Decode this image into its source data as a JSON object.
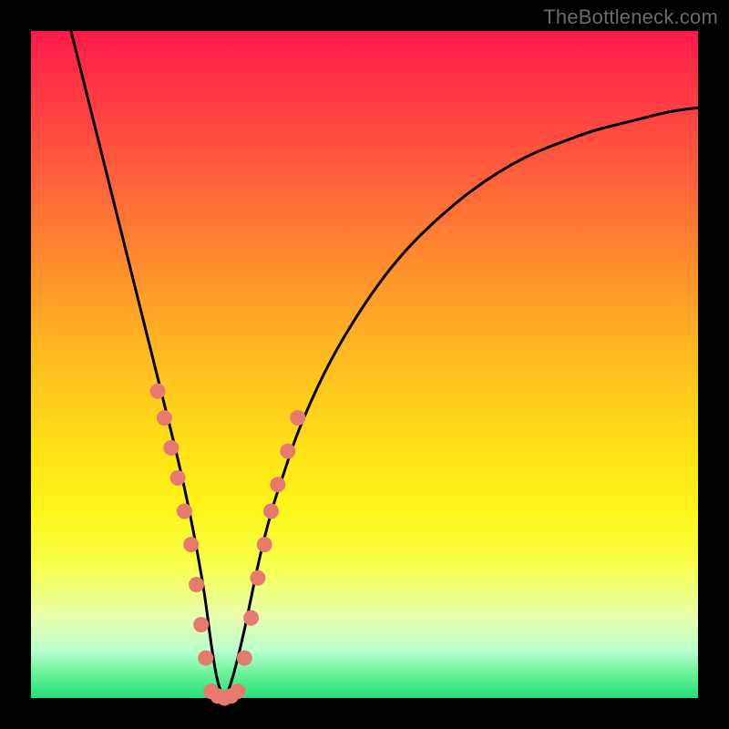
{
  "watermark": "TheBottleneck.com",
  "chart_data": {
    "type": "line",
    "title": "",
    "xlabel": "",
    "ylabel": "",
    "xlim": [
      0,
      100
    ],
    "ylim": [
      0,
      100
    ],
    "legend": false,
    "grid": false,
    "series": [
      {
        "name": "bottleneck-curve",
        "x": [
          6,
          8,
          10,
          12,
          14,
          16,
          18,
          20,
          22,
          24,
          26,
          27,
          28,
          29,
          30,
          32,
          34,
          36,
          38,
          40,
          44,
          48,
          52,
          56,
          60,
          64,
          68,
          72,
          76,
          80,
          84,
          88,
          92,
          96,
          100
        ],
        "values": [
          100,
          92,
          84,
          76,
          68,
          60,
          52,
          44,
          36,
          27,
          16,
          8,
          2,
          0,
          2,
          10,
          20,
          28,
          34,
          40,
          49,
          56,
          62,
          67,
          71,
          74.5,
          77.5,
          80,
          82,
          83.5,
          85,
          86,
          87,
          88,
          88.5
        ]
      }
    ],
    "markers": [
      {
        "name": "left-dots",
        "x": [
          19.0,
          20.0,
          21.0,
          22.0,
          23.0,
          24.0,
          24.8,
          25.5,
          26.2
        ],
        "y": [
          46,
          42,
          37.5,
          33,
          28,
          23,
          17,
          11,
          6
        ]
      },
      {
        "name": "bottom-dots",
        "x": [
          27.0,
          28.0,
          29.0,
          30.0,
          31.0
        ],
        "y": [
          1.0,
          0.3,
          0.0,
          0.3,
          1.0
        ]
      },
      {
        "name": "right-dots",
        "x": [
          32.0,
          33.0,
          34.0,
          35.0,
          36.0,
          37.0,
          38.5,
          40.0
        ],
        "y": [
          6,
          12,
          18,
          23,
          28,
          32,
          37,
          42
        ]
      }
    ],
    "background_gradient": {
      "top": "#ff1a4a",
      "mid_upper": "#ffb820",
      "mid_lower": "#fdf61a",
      "bottom": "#22e07a"
    }
  }
}
